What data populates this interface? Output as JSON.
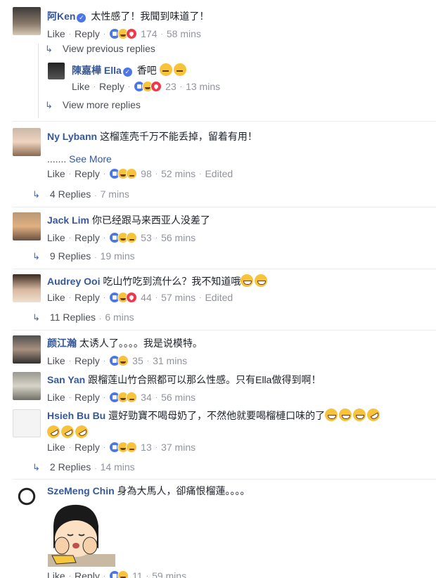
{
  "labels": {
    "like": "Like",
    "reply": "Reply",
    "edited": "Edited",
    "see_more": "See More"
  },
  "comments": [
    {
      "name": "阿Ken",
      "text": "太性感了！我聞到味道了！",
      "count": "174",
      "time": "58 mins"
    },
    {
      "name": "Ny Lybann",
      "text": "这榴莲壳千万不能丢掉，留着有用！",
      "more": ".......",
      "count": "98",
      "time": "52 mins",
      "replies": "4 Replies",
      "replies_time": "7 mins"
    },
    {
      "name": "Jack Lim",
      "text": "你已经跟马来西亚人没差了",
      "count": "53",
      "time": "56 mins",
      "replies": "9 Replies",
      "replies_time": "19 mins"
    },
    {
      "name": "Audrey Ooi",
      "text": "吃山竹吃到流什么？我不知道哦",
      "count": "44",
      "time": "57 mins",
      "replies": "11 Replies",
      "replies_time": "6 mins"
    },
    {
      "name": "颜江瀚",
      "text": "太诱人了。。。。我是说模特。",
      "count": "35",
      "time": "31 mins"
    },
    {
      "name": "San Yan",
      "text": "跟榴莲山竹合照都可以那么性感。只有Ella做得到啊！",
      "count": "34",
      "time": "56 mins"
    },
    {
      "name": "Hsieh Bu Bu",
      "text": "還好勁寶不喝母奶了，不然他就要喝榴槤口味的了",
      "count": "13",
      "time": "37 mins",
      "replies": "2 Replies",
      "replies_time": "14 mins"
    },
    {
      "name": "SzeMeng Chin",
      "text": "身為大馬人，卻痛恨榴蓮。。。。",
      "count": "11",
      "time": "59 mins"
    }
  ],
  "thread": {
    "previous": "View previous replies",
    "more": "View more replies",
    "reply": {
      "name": "陳嘉樺 Ella",
      "text": "香吧",
      "count": "23",
      "time": "13 mins"
    }
  }
}
